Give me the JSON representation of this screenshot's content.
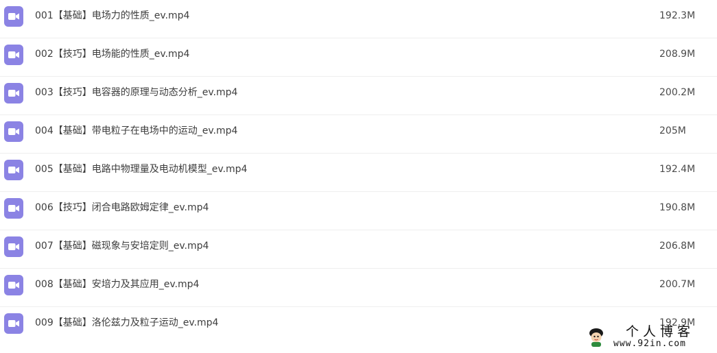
{
  "files": [
    {
      "name": "001【基础】电场力的性质_ev.mp4",
      "size": "192.3M",
      "icon": "video-file-icon"
    },
    {
      "name": "002【技巧】电场能的性质_ev.mp4",
      "size": "208.9M",
      "icon": "video-file-icon"
    },
    {
      "name": "003【技巧】电容器的原理与动态分析_ev.mp4",
      "size": "200.2M",
      "icon": "video-file-icon"
    },
    {
      "name": "004【基础】带电粒子在电场中的运动_ev.mp4",
      "size": "205M",
      "icon": "video-file-icon"
    },
    {
      "name": "005【基础】电路中物理量及电动机模型_ev.mp4",
      "size": "192.4M",
      "icon": "video-file-icon"
    },
    {
      "name": "006【技巧】闭合电路欧姆定律_ev.mp4",
      "size": "190.8M",
      "icon": "video-file-icon"
    },
    {
      "name": "007【基础】磁现象与安培定则_ev.mp4",
      "size": "206.8M",
      "icon": "video-file-icon"
    },
    {
      "name": "008【基础】安培力及其应用_ev.mp4",
      "size": "200.7M",
      "icon": "video-file-icon"
    },
    {
      "name": "009【基础】洛伦兹力及粒子运动_ev.mp4",
      "size": "192.9M",
      "icon": "video-file-icon"
    }
  ],
  "watermark": {
    "title": "个人博客",
    "url": "www.92in.com"
  },
  "colors": {
    "icon_bg": "#8b83e4",
    "text": "#3d3d3d",
    "divider": "#eeeeee"
  }
}
